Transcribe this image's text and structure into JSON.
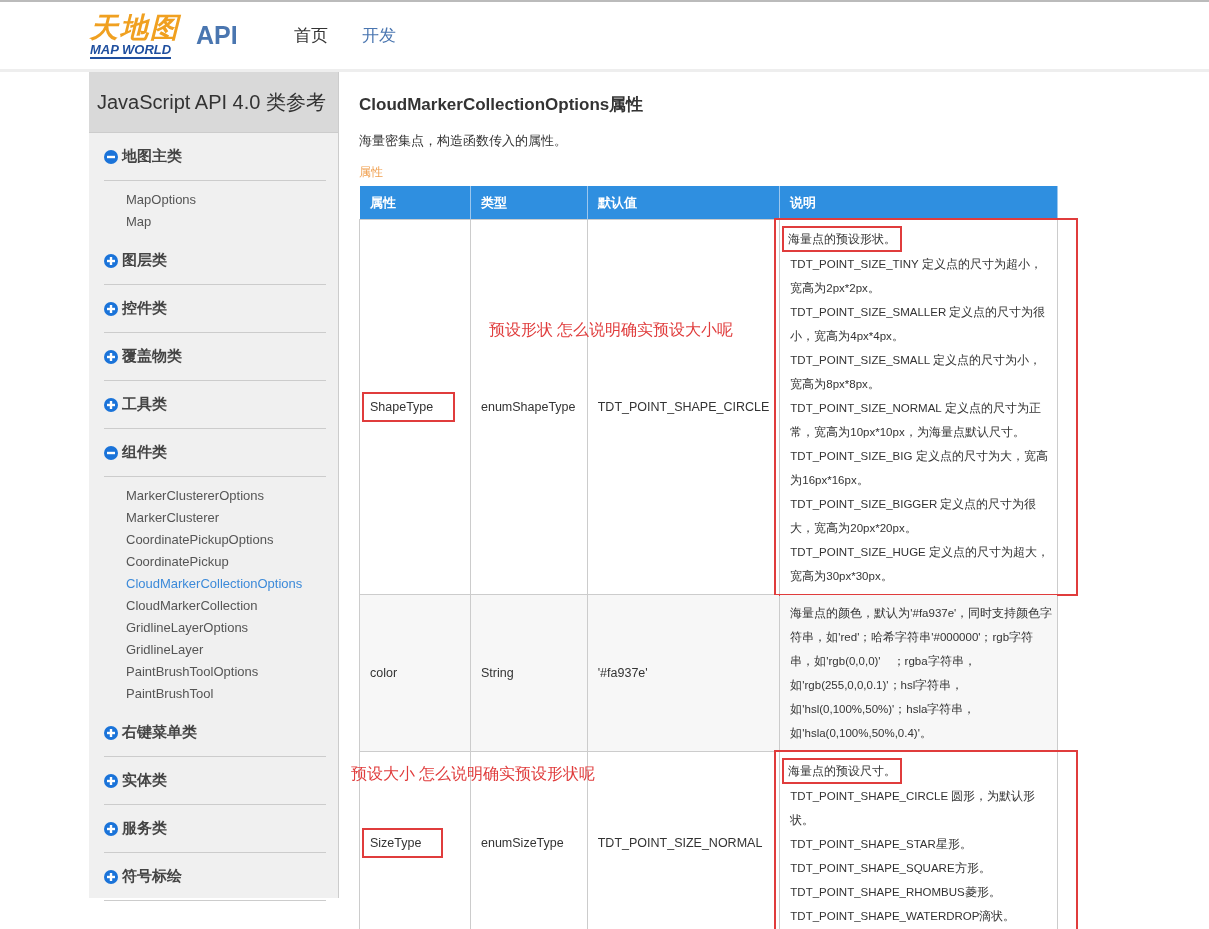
{
  "header": {
    "logo": {
      "cn": "天地图",
      "en": "MAP WORLD"
    },
    "product": "API",
    "nav": [
      {
        "label": "首页",
        "selected": false
      },
      {
        "label": "开发",
        "selected": true
      }
    ]
  },
  "sidebar": {
    "title": "JavaScript API 4.0 类参考",
    "groups": [
      {
        "label": "地图主类",
        "expanded": true,
        "items": [
          {
            "label": "MapOptions",
            "selected": false
          },
          {
            "label": "Map",
            "selected": false
          }
        ]
      },
      {
        "label": "图层类",
        "expanded": false
      },
      {
        "label": "控件类",
        "expanded": false
      },
      {
        "label": "覆盖物类",
        "expanded": false
      },
      {
        "label": "工具类",
        "expanded": false
      },
      {
        "label": "组件类",
        "expanded": true,
        "items": [
          {
            "label": "MarkerClustererOptions",
            "selected": false
          },
          {
            "label": "MarkerClusterer",
            "selected": false
          },
          {
            "label": "CoordinatePickupOptions",
            "selected": false
          },
          {
            "label": "CoordinatePickup",
            "selected": false
          },
          {
            "label": "CloudMarkerCollectionOptions",
            "selected": true
          },
          {
            "label": "CloudMarkerCollection",
            "selected": false
          },
          {
            "label": "GridlineLayerOptions",
            "selected": false
          },
          {
            "label": "GridlineLayer",
            "selected": false
          },
          {
            "label": "PaintBrushToolOptions",
            "selected": false
          },
          {
            "label": "PaintBrushTool",
            "selected": false
          }
        ]
      },
      {
        "label": "右键菜单类",
        "expanded": false
      },
      {
        "label": "实体类",
        "expanded": false
      },
      {
        "label": "服务类",
        "expanded": false
      },
      {
        "label": "符号标绘",
        "expanded": false
      }
    ]
  },
  "content": {
    "title": "CloudMarkerCollectionOptions属性",
    "description": "海量密集点，构造函数传入的属性。",
    "section": "属性",
    "table": {
      "columns": [
        "属性",
        "类型",
        "默认值",
        "说明"
      ],
      "rows": [
        {
          "name": {
            "text": "ShapeType",
            "boxed": true
          },
          "type": "enumShapeType",
          "default": "TDT_POINT_SHAPE_CIRCLE",
          "note": "预设形状  怎么说明确实预设大小呢",
          "description": {
            "boxed": true,
            "paragraphs": [
              {
                "text": "海量点的预设形状。",
                "boxed": true
              },
              {
                "text": "TDT_POINT_SIZE_TINY 定义点的尺寸为超小，宽高为2px*2px。",
                "boxed": false
              },
              {
                "text": "TDT_POINT_SIZE_SMALLER 定义点的尺寸为很小，宽高为4px*4px。",
                "boxed": false
              },
              {
                "text": "TDT_POINT_SIZE_SMALL 定义点的尺寸为小，宽高为8px*8px。",
                "boxed": false
              },
              {
                "text": "TDT_POINT_SIZE_NORMAL 定义点的尺寸为正常，宽高为10px*10px，为海量点默认尺寸。",
                "boxed": false
              },
              {
                "text": "TDT_POINT_SIZE_BIG 定义点的尺寸为大，宽高为16px*16px。",
                "boxed": false
              },
              {
                "text": "TDT_POINT_SIZE_BIGGER 定义点的尺寸为很大，宽高为20px*20px。",
                "boxed": false
              },
              {
                "text": "TDT_POINT_SIZE_HUGE 定义点的尺寸为超大，宽高为30px*30px。",
                "boxed": false
              }
            ]
          }
        },
        {
          "name": {
            "text": "color",
            "boxed": false
          },
          "type": "String",
          "default": "'#fa937e'",
          "description": {
            "boxed": false,
            "paragraphs": [
              {
                "text": "海量点的颜色，默认为'#fa937e'，同时支持颜色字符串，如'red'；哈希字符串'#000000'；rgb字符串，如'rgb(0,0,0)'　；rgba字符串，如'rgb(255,0,0,0.1)'；hsl字符串，如'hsl(0,100%,50%)'；hsla字符串，如'hsla(0,100%,50%,0.4)'。",
                "boxed": false
              }
            ]
          }
        },
        {
          "name": {
            "text": "SizeType",
            "boxed": true
          },
          "type": "enumSizeType",
          "default": "TDT_POINT_SIZE_NORMAL",
          "note": "预设大小 怎么说明确实预设形状呢",
          "description": {
            "boxed": true,
            "paragraphs": [
              {
                "text": "海量点的预设尺寸。",
                "boxed": true
              },
              {
                "text": "TDT_POINT_SHAPE_CIRCLE 圆形，为默认形状。",
                "boxed": false
              },
              {
                "text": "TDT_POINT_SHAPE_STAR星形。",
                "boxed": false
              },
              {
                "text": "TDT_POINT_SHAPE_SQUARE方形。",
                "boxed": false
              },
              {
                "text": "TDT_POINT_SHAPE_RHOMBUS菱形。",
                "boxed": false
              },
              {
                "text": "TDT_POINT_SHAPE_WATERDROP滴状。",
                "boxed": false
              }
            ]
          }
        }
      ]
    }
  }
}
